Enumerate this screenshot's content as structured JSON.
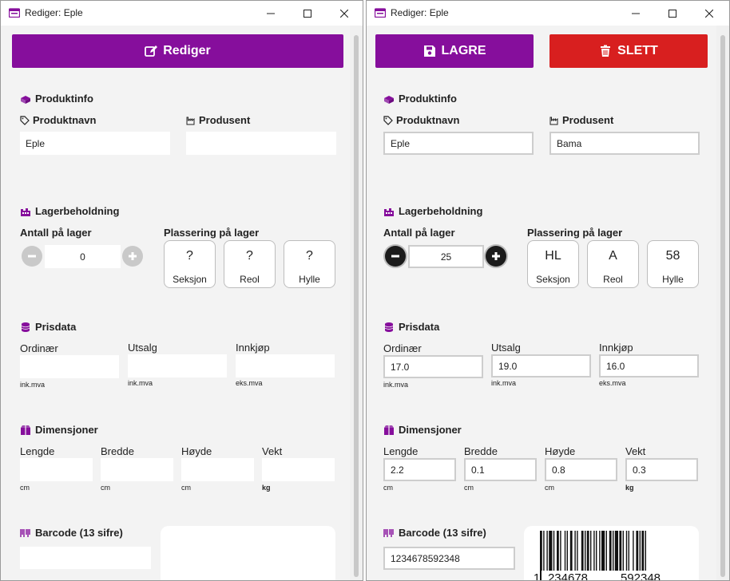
{
  "colors": {
    "accent": "#860e9c",
    "danger": "#d81f1f"
  },
  "left": {
    "window_title": "Rediger: Eple",
    "edit_button": "Rediger",
    "produktinfo": {
      "heading": "Produktinfo",
      "name_label": "Produktnavn",
      "name_value": "Eple",
      "maker_label": "Produsent",
      "maker_value": ""
    },
    "lager": {
      "heading": "Lagerbeholdning",
      "count_label": "Antall på lager",
      "count_value": "0",
      "place_label": "Plassering på lager",
      "seksjon": "?",
      "seksjon_label": "Seksjon",
      "reol": "?",
      "reol_label": "Reol",
      "hylle": "?",
      "hylle_label": "Hylle"
    },
    "pris": {
      "heading": "Prisdata",
      "ordinaer_label": "Ordinær",
      "ordinaer_value": "",
      "ordinaer_note": "ink.mva",
      "utsalg_label": "Utsalg",
      "utsalg_value": "",
      "utsalg_note": "ink.mva",
      "innkjop_label": "Innkjøp",
      "innkjop_value": "",
      "innkjop_note": "eks.mva"
    },
    "dim": {
      "heading": "Dimensjoner",
      "lengde_label": "Lengde",
      "lengde_value": "",
      "lengde_unit": "cm",
      "bredde_label": "Bredde",
      "bredde_value": "",
      "bredde_unit": "cm",
      "hoyde_label": "Høyde",
      "hoyde_value": "",
      "hoyde_unit": "cm",
      "vekt_label": "Vekt",
      "vekt_value": "",
      "vekt_unit": "kg"
    },
    "barcode": {
      "heading": "Barcode (13 sifre)",
      "value": ""
    }
  },
  "right": {
    "window_title": "Rediger: Eple",
    "save_button": "LAGRE",
    "delete_button": "SLETT",
    "produktinfo": {
      "heading": "Produktinfo",
      "name_label": "Produktnavn",
      "name_value": "Eple",
      "maker_label": "Produsent",
      "maker_value": "Bama"
    },
    "lager": {
      "heading": "Lagerbeholdning",
      "count_label": "Antall på lager",
      "count_value": "25",
      "place_label": "Plassering på lager",
      "seksjon": "HL",
      "seksjon_label": "Seksjon",
      "reol": "A",
      "reol_label": "Reol",
      "hylle": "58",
      "hylle_label": "Hylle"
    },
    "pris": {
      "heading": "Prisdata",
      "ordinaer_label": "Ordinær",
      "ordinaer_value": "17.0",
      "ordinaer_note": "ink.mva",
      "utsalg_label": "Utsalg",
      "utsalg_value": "19.0",
      "utsalg_note": "ink.mva",
      "innkjop_label": "Innkjøp",
      "innkjop_value": "16.0",
      "innkjop_note": "eks.mva"
    },
    "dim": {
      "heading": "Dimensjoner",
      "lengde_label": "Lengde",
      "lengde_value": "2.2",
      "lengde_unit": "cm",
      "bredde_label": "Bredde",
      "bredde_value": "0.1",
      "bredde_unit": "cm",
      "hoyde_label": "Høyde",
      "hoyde_value": "0.8",
      "hoyde_unit": "cm",
      "vekt_label": "Vekt",
      "vekt_value": "0.3",
      "vekt_unit": "kg"
    },
    "barcode": {
      "heading": "Barcode (13 sifre)",
      "value": "1234678592348",
      "digit_first": "1",
      "digits_left": "234678",
      "digits_right": "592348"
    }
  }
}
